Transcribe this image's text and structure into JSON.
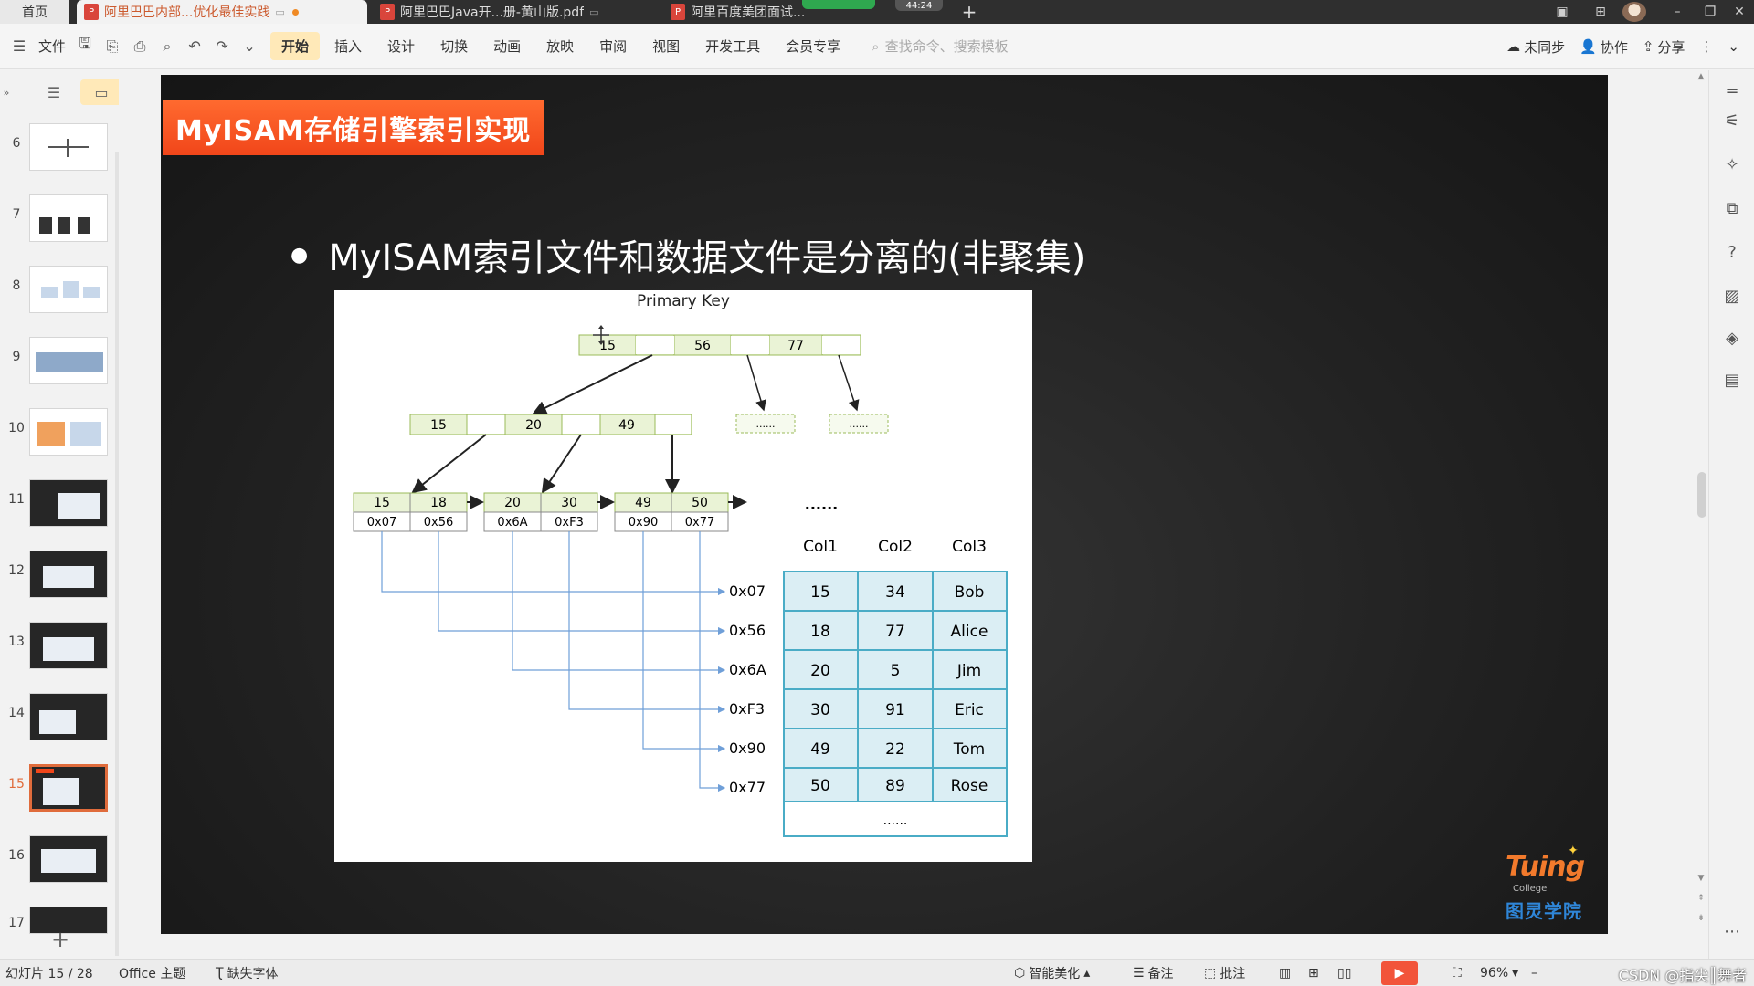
{
  "tabs": {
    "home": "首页",
    "active": "阿里巴巴内部...优化最佳实践",
    "tab2": "阿里巴巴Java开...册-黄山版.pdf",
    "tab3": "阿里百度美团面试..."
  },
  "recording": {
    "time": "44:24"
  },
  "ribbon": {
    "file_label": "文件",
    "menu": [
      "开始",
      "插入",
      "设计",
      "切换",
      "动画",
      "放映",
      "审阅",
      "视图",
      "开发工具",
      "会员专享"
    ],
    "active_menu": "开始",
    "search_placeholder": "查找命令、搜索模板",
    "unsynced": "未同步",
    "collab": "协作",
    "share": "分享"
  },
  "thumbnails": {
    "numbers": [
      "6",
      "7",
      "8",
      "9",
      "10",
      "11",
      "12",
      "13",
      "14",
      "15",
      "16",
      "17"
    ],
    "active": "15"
  },
  "slide": {
    "title": "MyISAM存储引擎索引实现",
    "bullet": "MyISAM索引文件和数据文件是分离的(非聚集)",
    "diagram": {
      "primary_key_label": "Primary Key",
      "root_keys": [
        "15",
        "56",
        "77"
      ],
      "level2_keys": [
        "15",
        "20",
        "49"
      ],
      "placeholder": "......",
      "leaves": [
        {
          "keys": [
            "15",
            "18"
          ],
          "addrs": [
            "0x07",
            "0x56"
          ]
        },
        {
          "keys": [
            "20",
            "30"
          ],
          "addrs": [
            "0x6A",
            "0xF3"
          ]
        },
        {
          "keys": [
            "49",
            "50"
          ],
          "addrs": [
            "0x90",
            "0x77"
          ]
        }
      ],
      "ellipsis": "......",
      "addresses": [
        "0x07",
        "0x56",
        "0x6A",
        "0xF3",
        "0x90",
        "0x77"
      ],
      "table": {
        "headers": [
          "Col1",
          "Col2",
          "Col3"
        ],
        "rows": [
          [
            "15",
            "34",
            "Bob"
          ],
          [
            "18",
            "77",
            "Alice"
          ],
          [
            "20",
            "5",
            "Jim"
          ],
          [
            "30",
            "91",
            "Eric"
          ],
          [
            "49",
            "22",
            "Tom"
          ],
          [
            "50",
            "89",
            "Rose"
          ]
        ],
        "footer": "......"
      }
    },
    "logo": {
      "word": "Tuing",
      "college": "College",
      "cn": "图灵学院"
    }
  },
  "statusbar": {
    "slide_counter": "幻灯片 15 / 28",
    "theme": "Office 主题",
    "missing_font": "缺失字体",
    "beautify": "智能美化",
    "notes": "备注",
    "comments": "批注",
    "zoom": "96%",
    "watermark": "CSDN @指尖║舞者"
  },
  "colors": {
    "accent_orange": "#f1461a",
    "node_fill": "#eaf3d6",
    "node_stroke": "#9bbb59",
    "table_fill": "#dbeef4",
    "table_stroke": "#4aacc6",
    "pointer_blue": "#6f9fd8"
  },
  "icons": [
    "menu-icon",
    "save-icon",
    "print-icon",
    "undo-icon",
    "redo-icon",
    "search-icon",
    "cloud-icon",
    "user-icon",
    "share-icon",
    "play-icon",
    "zoom-fit-icon"
  ]
}
